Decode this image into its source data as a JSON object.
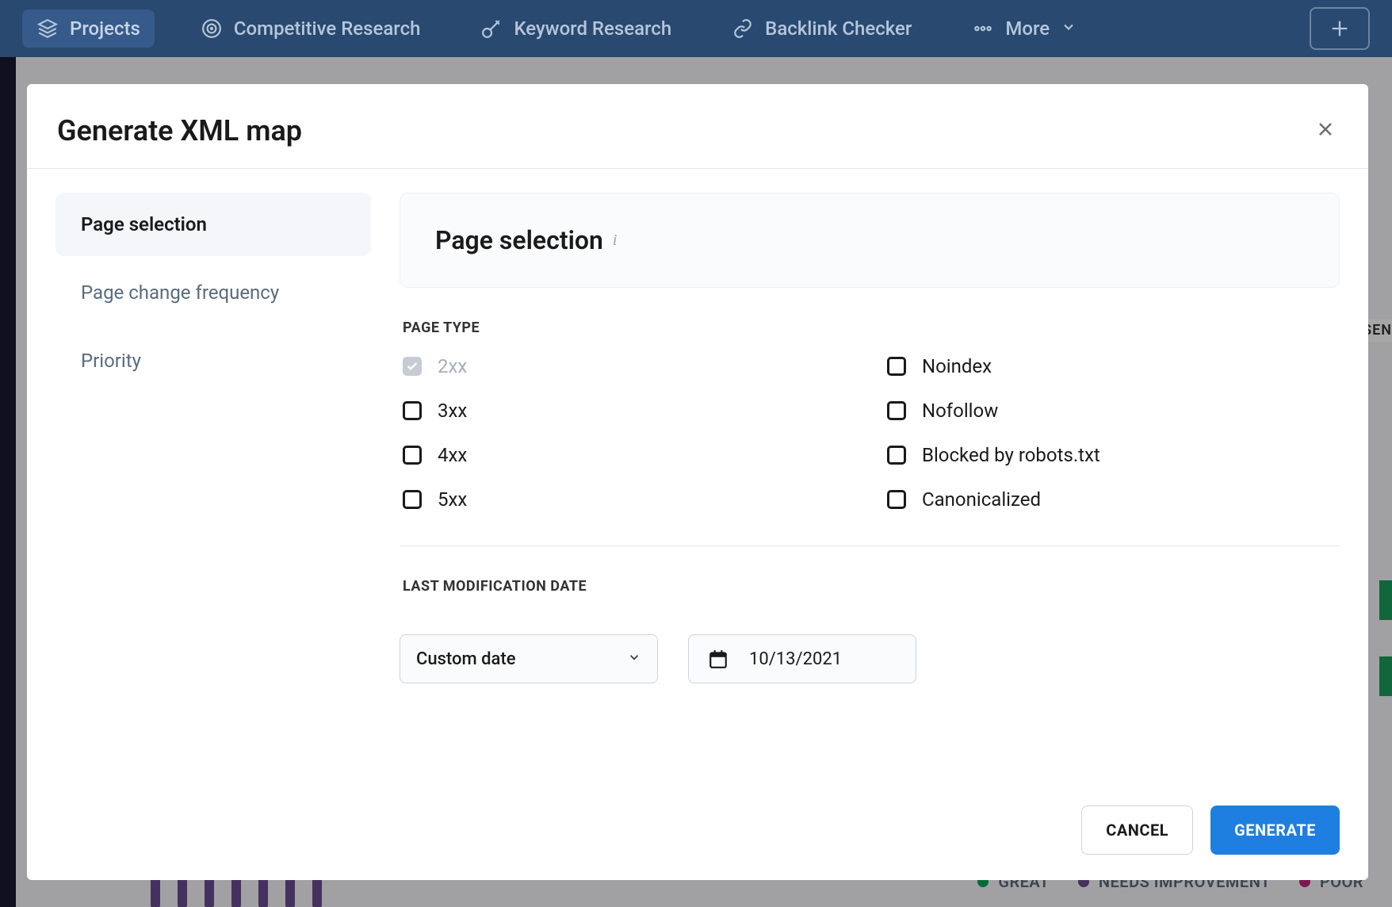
{
  "nav": {
    "items": [
      {
        "label": "Projects",
        "icon": "layers"
      },
      {
        "label": "Competitive Research",
        "icon": "target"
      },
      {
        "label": "Keyword Research",
        "icon": "key"
      },
      {
        "label": "Backlink Checker",
        "icon": "link"
      },
      {
        "label": "More",
        "icon": "more"
      }
    ]
  },
  "legend": {
    "great": "GREAT",
    "improve": "NEEDS IMPROVEMENT",
    "poor": "POOR"
  },
  "bg": {
    "badge": "SEN"
  },
  "modal": {
    "title": "Generate XML map",
    "tabs": [
      {
        "label": "Page selection"
      },
      {
        "label": "Page change frequency"
      },
      {
        "label": "Priority"
      }
    ],
    "section_title": "Page selection",
    "page_type_label": "PAGE TYPE",
    "page_types_left": [
      {
        "label": "2xx",
        "checked": true,
        "disabled": true
      },
      {
        "label": "3xx",
        "checked": false
      },
      {
        "label": "4xx",
        "checked": false
      },
      {
        "label": "5xx",
        "checked": false
      }
    ],
    "page_types_right": [
      {
        "label": "Noindex",
        "checked": false
      },
      {
        "label": "Nofollow",
        "checked": false
      },
      {
        "label": "Blocked by robots.txt",
        "checked": false
      },
      {
        "label": "Canonicalized",
        "checked": false
      }
    ],
    "last_mod_label": "LAST MODIFICATION DATE",
    "date_mode": "Custom date",
    "date_value": "10/13/2021",
    "cancel": "CANCEL",
    "generate": "GENERATE"
  }
}
